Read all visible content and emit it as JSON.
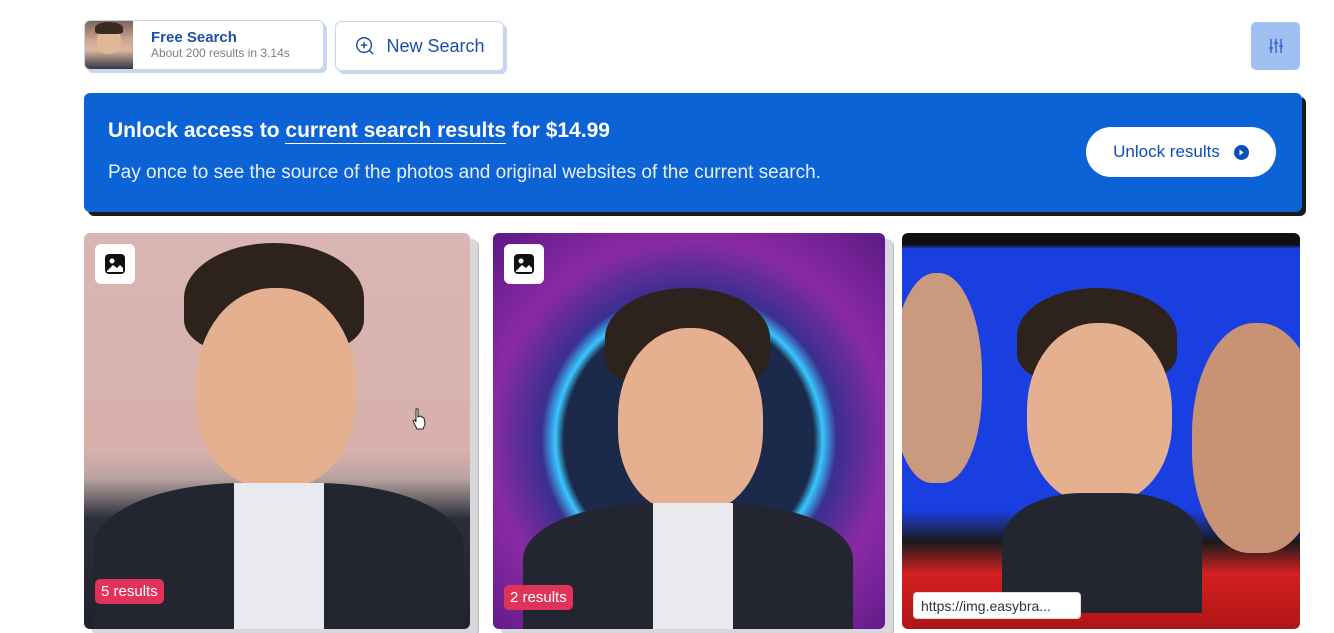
{
  "header": {
    "search_title": "Free Search",
    "search_subtitle": "About 200 results in 3.14s",
    "new_search_label": "New Search",
    "filter_icon": "sliders-icon"
  },
  "banner": {
    "title_prefix": "Unlock access to ",
    "title_link": "current search results",
    "title_suffix": " for $14.99",
    "subtitle": "Pay once to see the source of the photos and original websites of the current search.",
    "button_label": "Unlock results",
    "button_icon": "arrow-circle-icon",
    "color": "#0b63d6"
  },
  "results": [
    {
      "icon": "image-icon",
      "badge": "5 results"
    },
    {
      "icon": "image-icon",
      "badge": "2 results"
    },
    {
      "url": "https://img.easybra..."
    }
  ],
  "colors": {
    "accent": "#1e4fa8",
    "badge": "#e0335a",
    "filter_button": "#9fc0f0"
  }
}
